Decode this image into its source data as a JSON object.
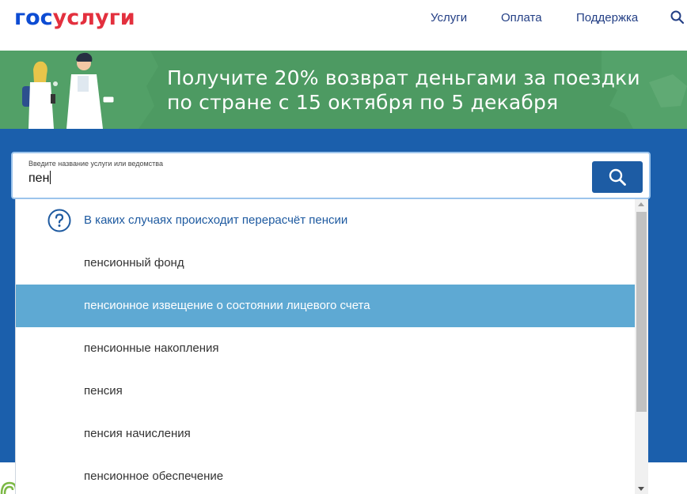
{
  "header": {
    "logo_part1": "гос",
    "logo_part2": "услуги",
    "nav": [
      "Услуги",
      "Оплата",
      "Поддержка"
    ]
  },
  "banner": {
    "line1": "Получите 20% возврат деньгами за поездки",
    "line2": "по стране с 15 октября по 5 декабря"
  },
  "search": {
    "label": "Введите название услуги или ведомства",
    "value": "пен"
  },
  "suggestions": [
    {
      "label": "В каких случаях происходит перерасчёт пенсии"
    },
    {
      "label": "пенсионный фонд"
    },
    {
      "label": "пенсионное извещение о состоянии лицевого счета"
    },
    {
      "label": "пенсионные накопления"
    },
    {
      "label": "пенсия"
    },
    {
      "label": "пенсия начисления"
    },
    {
      "label": "пенсионное обеспечение"
    }
  ],
  "colors": {
    "brand_blue": "#0d4cd3",
    "brand_red": "#e3303e",
    "banner_green": "#4d9a62",
    "page_blue": "#1b5fac",
    "selected_row": "#5ea9d3"
  },
  "icons": {
    "search": "search-icon",
    "help": "question-circle-icon"
  }
}
